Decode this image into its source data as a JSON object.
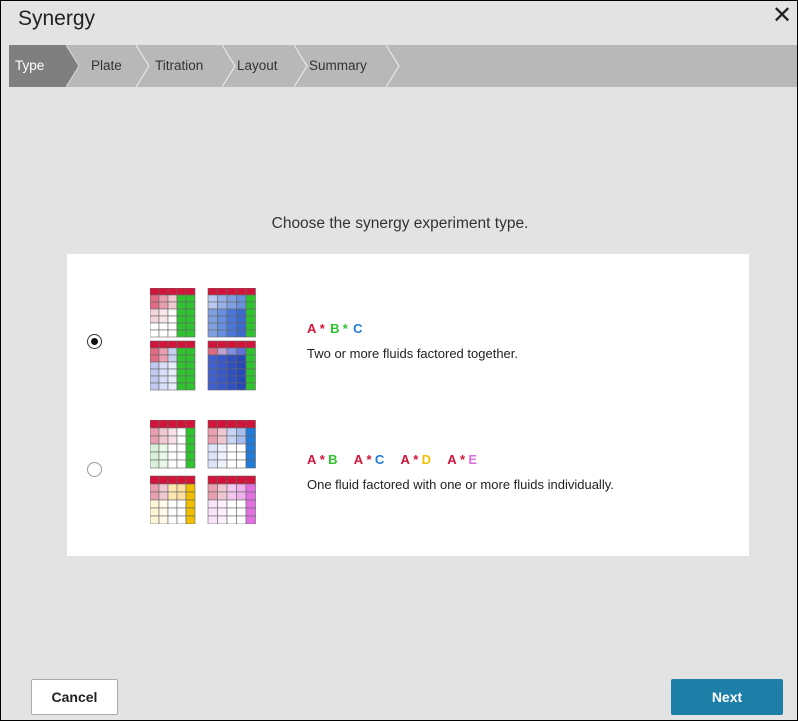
{
  "dialog": {
    "title": "Synergy"
  },
  "steps": [
    {
      "label": "Type",
      "active": true
    },
    {
      "label": "Plate",
      "active": false
    },
    {
      "label": "Titration",
      "active": false
    },
    {
      "label": "Layout",
      "active": false
    },
    {
      "label": "Summary",
      "active": false
    }
  ],
  "prompt": "Choose the synergy experiment type.",
  "options": [
    {
      "selected": true,
      "formula": [
        {
          "text": "A",
          "color": "#d2143a"
        },
        {
          "text": "*",
          "color": "#d2143a"
        },
        {
          "text": "B",
          "color": "#2fc42f"
        },
        {
          "text": "*",
          "color": "#2fc42f"
        },
        {
          "text": "C",
          "color": "#1f7ad8"
        }
      ],
      "description": "Two or more fluids factored together."
    },
    {
      "selected": false,
      "formula": [
        {
          "text": "A",
          "color": "#d2143a"
        },
        {
          "text": "*",
          "color": "#d2143a"
        },
        {
          "text": "B",
          "color": "#2fc42f"
        },
        {
          "text": "A",
          "color": "#d2143a"
        },
        {
          "text": "*",
          "color": "#d2143a"
        },
        {
          "text": "C",
          "color": "#1f7ad8"
        },
        {
          "text": "A",
          "color": "#d2143a"
        },
        {
          "text": "*",
          "color": "#d2143a"
        },
        {
          "text": "D",
          "color": "#f0c000"
        },
        {
          "text": "A",
          "color": "#d2143a"
        },
        {
          "text": "*",
          "color": "#d2143a"
        },
        {
          "text": "E",
          "color": "#e070e0"
        }
      ],
      "description": "One fluid factored with one or more fluids individually."
    }
  ],
  "buttons": {
    "cancel": "Cancel",
    "next": "Next"
  },
  "colors": {
    "accent": "#1d7fa8",
    "fluid_a": "#d2143a",
    "fluid_b": "#2fc42f",
    "fluid_c": "#1f7ad8",
    "fluid_d": "#f0c000",
    "fluid_e": "#e070e0"
  }
}
